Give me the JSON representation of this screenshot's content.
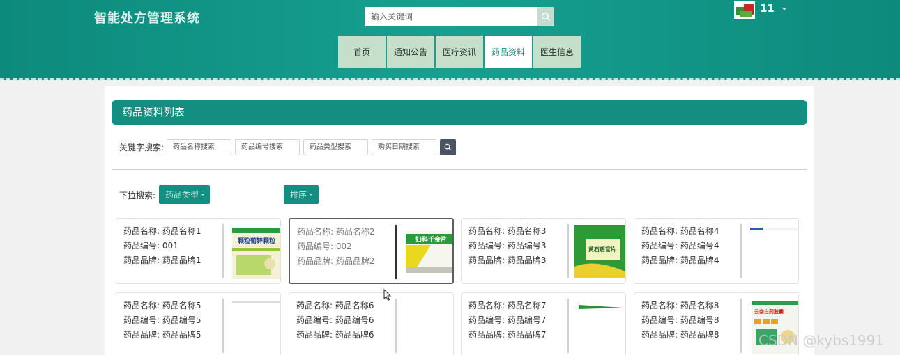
{
  "header": {
    "logo": "智能处方管理系统",
    "search_placeholder": "输入关键词",
    "username": "11"
  },
  "nav": [
    "首页",
    "通知公告",
    "医疗资讯",
    "药品资料",
    "医生信息"
  ],
  "nav_active": "药品资料",
  "panel_title": "药品资料列表",
  "filters": {
    "keyword_label": "关键字搜索:",
    "placeholders": [
      "药品名称搜索",
      "药品编号搜索",
      "药品类型搜索",
      "购买日期搜索"
    ],
    "dropdown_label": "下拉搜索:",
    "type_button": "药品类型",
    "sort_button": "排序"
  },
  "cards": [
    {
      "name": "药品名称: 药品名称1",
      "code": "药品编号: 001",
      "brand": "药品品牌: 药品品牌1"
    },
    {
      "name": "药品名称: 药品名称2",
      "code": "药品编号: 002",
      "brand": "药品品牌: 药品品牌2"
    },
    {
      "name": "药品名称: 药品名称3",
      "code": "药品编号: 药品编号3",
      "brand": "药品品牌: 药品品牌3"
    },
    {
      "name": "药品名称: 药品名称4",
      "code": "药品编号: 药品编号4",
      "brand": "药品品牌: 药品品牌4"
    },
    {
      "name": "药品名称: 药品名称5",
      "code": "药品编号: 药品编号5",
      "brand": "药品品牌: 药品品牌5"
    },
    {
      "name": "药品名称: 药品名称6",
      "code": "药品编号: 药品编号6",
      "brand": "药品品牌: 药品品牌6"
    },
    {
      "name": "药品名称: 药品名称7",
      "code": "药品编号: 药品编号7",
      "brand": "药品品牌: 药品品牌7"
    },
    {
      "name": "药品名称: 药品名称8",
      "code": "药品编号: 药品编号8",
      "brand": "药品品牌: 药品品牌8"
    }
  ],
  "thumb_texts": {
    "t1": "颗粒葡锌颗粒",
    "t2": "妇科千金片",
    "t3": "黄石盾官片",
    "t8": "云南白药胶囊"
  },
  "watermark": "CSDN @kybs1991"
}
